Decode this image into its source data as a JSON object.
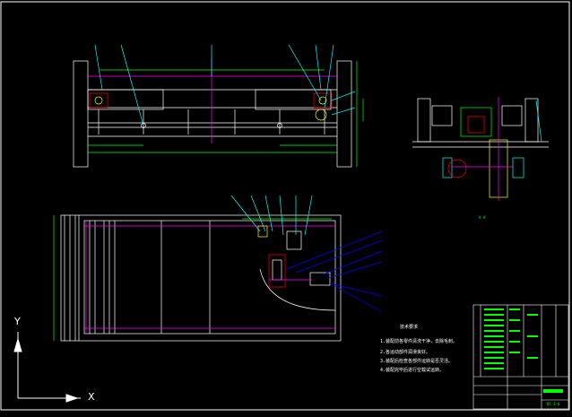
{
  "ucs": {
    "x_label": "X",
    "y_label": "Y"
  },
  "colors": {
    "background": "#000000",
    "frame": "#ffffff",
    "geometry": "#ffffff",
    "dimension": "#00ff00",
    "center": "#ff00ff",
    "leader": "#0000ff",
    "highlight": "#00ffff",
    "red": "#ff0000",
    "yellow": "#ffff00"
  },
  "notes": {
    "heading": "技术要求",
    "lines": [
      "1.装配前各零件清洗干净，去除毛刺。",
      "2.各运动部件润滑良好。",
      "3.装配后检查各部件运转是否灵活。",
      "4.装配完毕后进行空载试运转。"
    ]
  },
  "title_block": {
    "drawing_no": "DC-1-0"
  },
  "section_view_label": "A-A"
}
